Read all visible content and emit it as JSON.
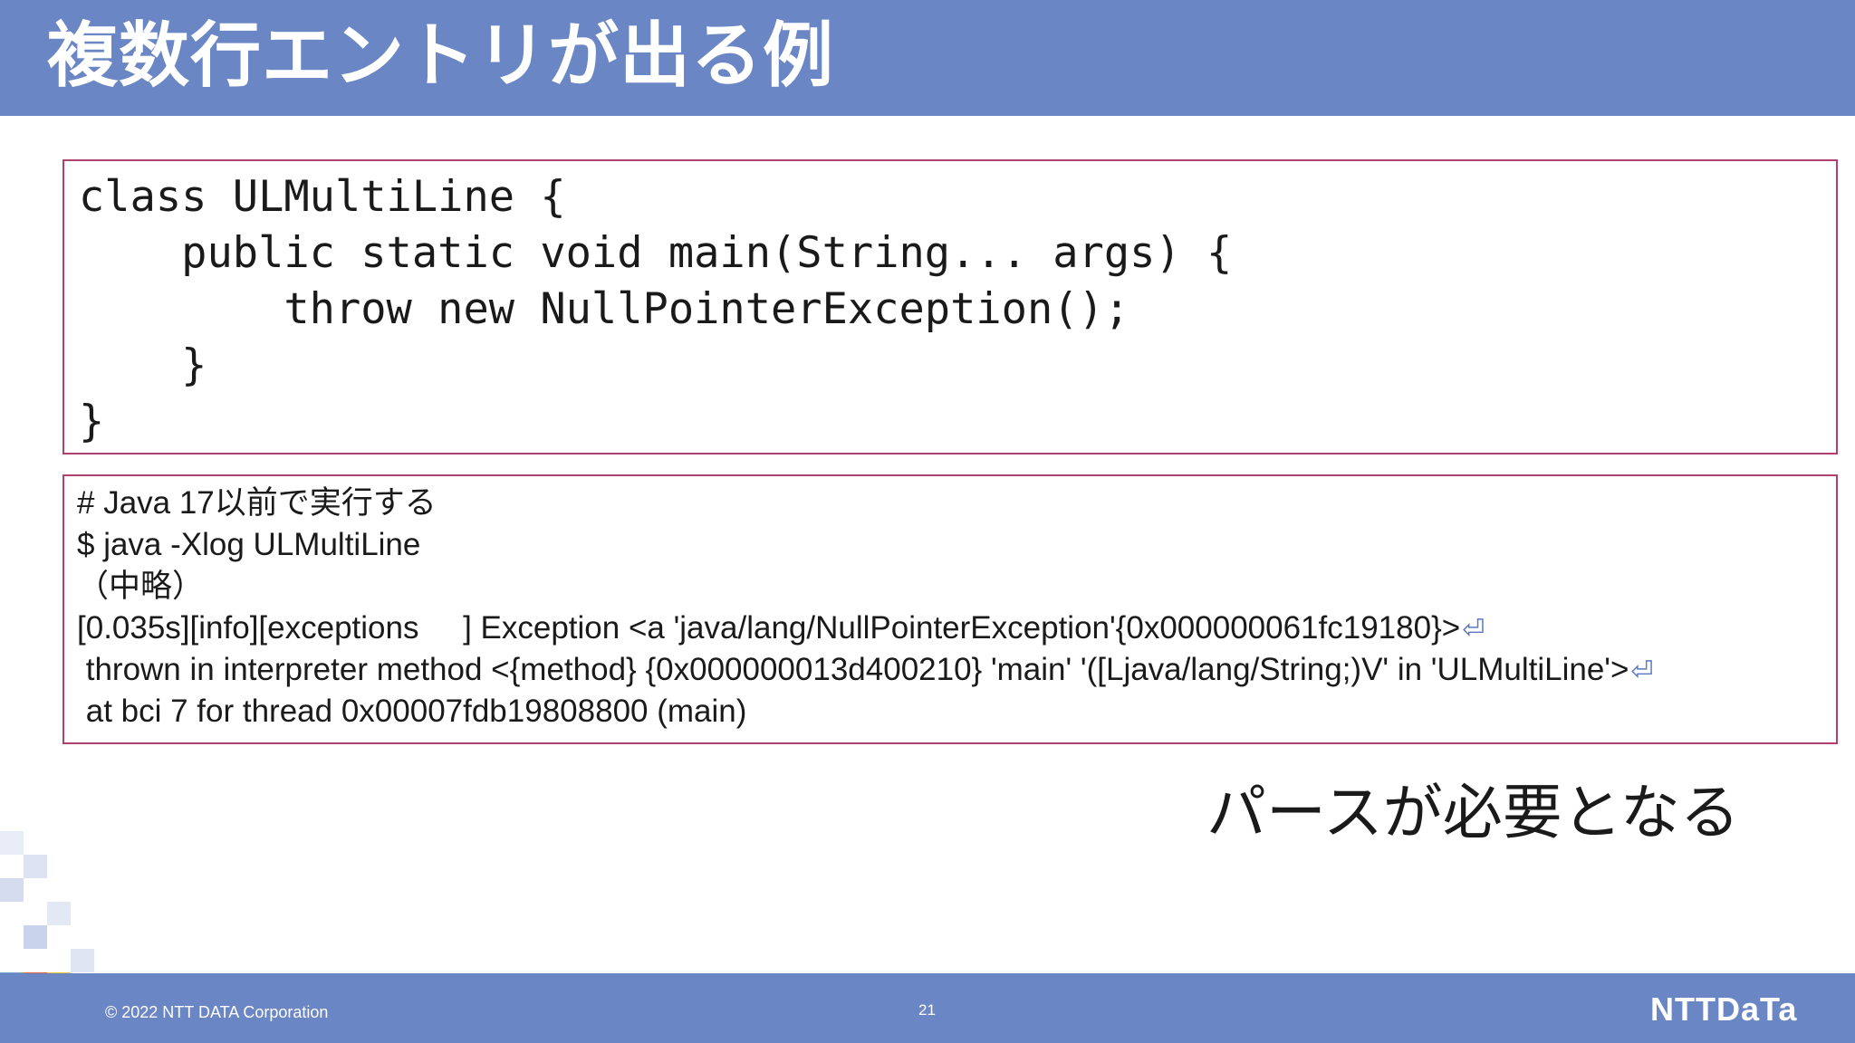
{
  "slide": {
    "title": "複数行エントリが出る例",
    "code_lines": [
      "class ULMultiLine {",
      "    public static void main(String... args) {",
      "        throw new NullPointerException();",
      "    }",
      "}"
    ],
    "log_lines": [
      "# Java 17以前で実行する",
      "$ java -Xlog ULMultiLine",
      "（中略）",
      "[0.035s][info][exceptions     ] Exception <a 'java/lang/NullPointerException'{0x000000061fc19180}>",
      " thrown in interpreter method <{method} {0x000000013d400210} 'main' '([Ljava/lang/String;)V' in 'ULMultiLine'>",
      " at bci 7 for thread 0x00007fdb19808800 (main)"
    ],
    "return_mark": "⏎",
    "note": "パースが必要となる"
  },
  "footer": {
    "copyright": "© 2022 NTT DATA Corporation",
    "page_number": "21",
    "logo_text": "NTTDaTa"
  },
  "colors": {
    "header_bg": "#6b86c4",
    "box_border": "#b0416f",
    "return_mark": "#5a78c0"
  }
}
